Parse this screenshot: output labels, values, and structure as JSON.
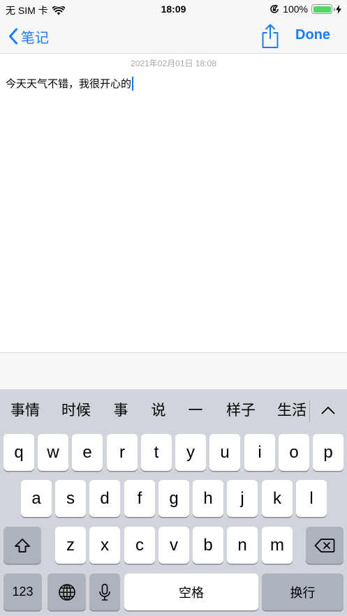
{
  "colors": {
    "accent": "#1a7cf4",
    "muted_text": "#a8a8a8",
    "battery_green": "#4cd964",
    "caret": "#1a7cf4"
  },
  "status_bar": {
    "carrier": "无 SIM 卡",
    "wifi_icon": "wifi-icon",
    "time": "18:09",
    "rotation_lock_icon": "rotation-lock-icon",
    "battery_percent": "100%",
    "battery_level": 1.0,
    "charging_icon": "charging-bolt-icon"
  },
  "nav": {
    "back_label": "笔记",
    "back_icon": "chevron-left-icon",
    "share_icon": "share-icon",
    "done_label": "Done"
  },
  "note": {
    "date": "2021年02月01日 18:08",
    "text": "今天天气不错，我很开心的"
  },
  "keyboard": {
    "candidates": [
      "事情",
      "时候",
      "事",
      "说",
      "一",
      "样子",
      "生活"
    ],
    "expand_icon": "chevron-up-icon",
    "row1": [
      "q",
      "w",
      "e",
      "r",
      "t",
      "y",
      "u",
      "i",
      "o",
      "p"
    ],
    "row2": [
      "a",
      "s",
      "d",
      "f",
      "g",
      "h",
      "j",
      "k",
      "l"
    ],
    "row3": [
      "z",
      "x",
      "c",
      "v",
      "b",
      "n",
      "m"
    ],
    "shift_icon": "shift-icon",
    "delete_icon": "backspace-icon",
    "numbers_label": "123",
    "globe_icon": "globe-icon",
    "mic_icon": "microphone-icon",
    "space_label": "空格",
    "return_label": "换行"
  }
}
